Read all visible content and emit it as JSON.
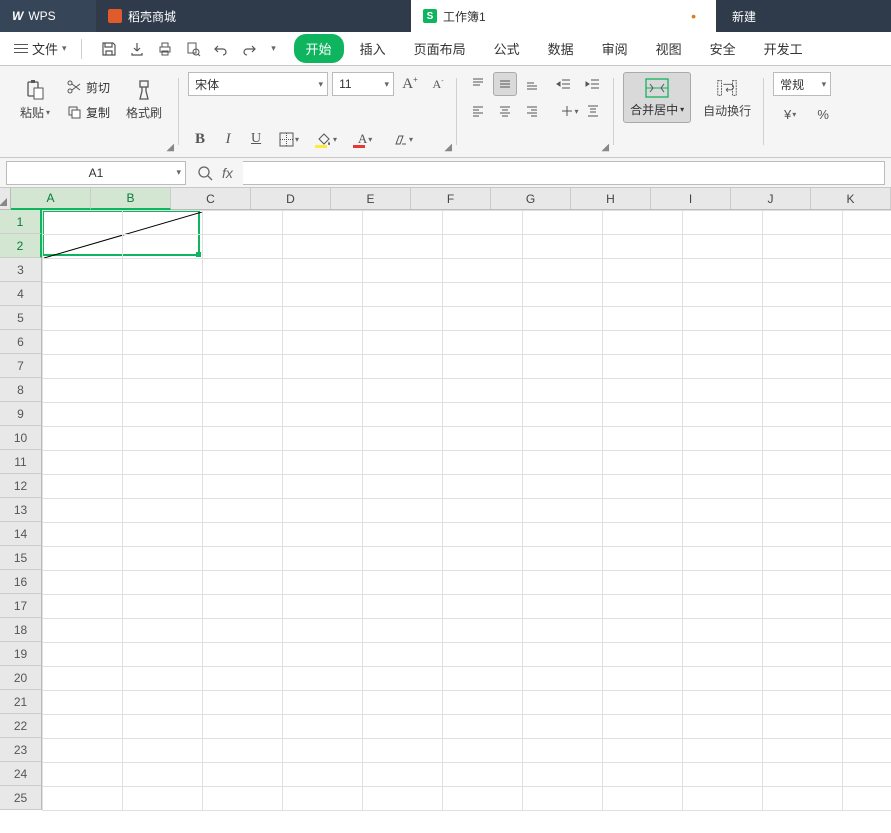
{
  "titlebar": {
    "wps": "WPS",
    "mall": "稻壳商城",
    "doc": "工作簿1",
    "newtab": "新建"
  },
  "menu": {
    "file": "文件",
    "tabs": [
      "开始",
      "插入",
      "页面布局",
      "公式",
      "数据",
      "审阅",
      "视图",
      "安全",
      "开发工"
    ],
    "active_index": 0
  },
  "ribbon": {
    "paste": "粘贴",
    "cut": "剪切",
    "copy": "复制",
    "format_painter": "格式刷",
    "font_name": "宋体",
    "font_size": "11",
    "merge": "合并居中",
    "wrap": "自动换行",
    "number_format": "常规"
  },
  "fx": {
    "namebox": "A1",
    "fx_label": "fx"
  },
  "grid": {
    "cols": [
      "A",
      "B",
      "C",
      "D",
      "E",
      "F",
      "G",
      "H",
      "I",
      "J",
      "K"
    ],
    "rows": [
      "1",
      "2",
      "3",
      "4",
      "5",
      "6",
      "7",
      "8",
      "9",
      "10",
      "11",
      "12",
      "13",
      "14",
      "15",
      "16",
      "17",
      "18",
      "19",
      "20",
      "21",
      "22",
      "23",
      "24",
      "25"
    ],
    "selected_cols": [
      0,
      1
    ],
    "selected_rows": [
      0,
      1
    ]
  }
}
